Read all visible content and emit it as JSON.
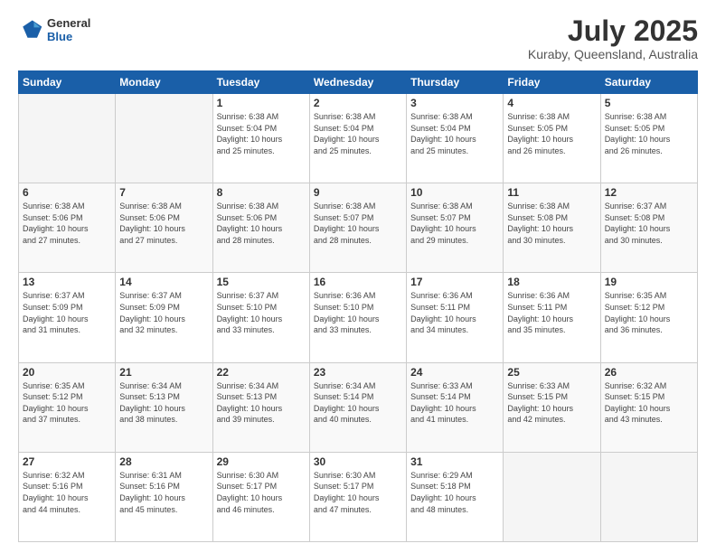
{
  "header": {
    "logo_line1": "General",
    "logo_line2": "Blue",
    "month_title": "July 2025",
    "location": "Kuraby, Queensland, Australia"
  },
  "days_of_week": [
    "Sunday",
    "Monday",
    "Tuesday",
    "Wednesday",
    "Thursday",
    "Friday",
    "Saturday"
  ],
  "weeks": [
    [
      {
        "day": "",
        "info": ""
      },
      {
        "day": "",
        "info": ""
      },
      {
        "day": "1",
        "info": "Sunrise: 6:38 AM\nSunset: 5:04 PM\nDaylight: 10 hours\nand 25 minutes."
      },
      {
        "day": "2",
        "info": "Sunrise: 6:38 AM\nSunset: 5:04 PM\nDaylight: 10 hours\nand 25 minutes."
      },
      {
        "day": "3",
        "info": "Sunrise: 6:38 AM\nSunset: 5:04 PM\nDaylight: 10 hours\nand 25 minutes."
      },
      {
        "day": "4",
        "info": "Sunrise: 6:38 AM\nSunset: 5:05 PM\nDaylight: 10 hours\nand 26 minutes."
      },
      {
        "day": "5",
        "info": "Sunrise: 6:38 AM\nSunset: 5:05 PM\nDaylight: 10 hours\nand 26 minutes."
      }
    ],
    [
      {
        "day": "6",
        "info": "Sunrise: 6:38 AM\nSunset: 5:06 PM\nDaylight: 10 hours\nand 27 minutes."
      },
      {
        "day": "7",
        "info": "Sunrise: 6:38 AM\nSunset: 5:06 PM\nDaylight: 10 hours\nand 27 minutes."
      },
      {
        "day": "8",
        "info": "Sunrise: 6:38 AM\nSunset: 5:06 PM\nDaylight: 10 hours\nand 28 minutes."
      },
      {
        "day": "9",
        "info": "Sunrise: 6:38 AM\nSunset: 5:07 PM\nDaylight: 10 hours\nand 28 minutes."
      },
      {
        "day": "10",
        "info": "Sunrise: 6:38 AM\nSunset: 5:07 PM\nDaylight: 10 hours\nand 29 minutes."
      },
      {
        "day": "11",
        "info": "Sunrise: 6:38 AM\nSunset: 5:08 PM\nDaylight: 10 hours\nand 30 minutes."
      },
      {
        "day": "12",
        "info": "Sunrise: 6:37 AM\nSunset: 5:08 PM\nDaylight: 10 hours\nand 30 minutes."
      }
    ],
    [
      {
        "day": "13",
        "info": "Sunrise: 6:37 AM\nSunset: 5:09 PM\nDaylight: 10 hours\nand 31 minutes."
      },
      {
        "day": "14",
        "info": "Sunrise: 6:37 AM\nSunset: 5:09 PM\nDaylight: 10 hours\nand 32 minutes."
      },
      {
        "day": "15",
        "info": "Sunrise: 6:37 AM\nSunset: 5:10 PM\nDaylight: 10 hours\nand 33 minutes."
      },
      {
        "day": "16",
        "info": "Sunrise: 6:36 AM\nSunset: 5:10 PM\nDaylight: 10 hours\nand 33 minutes."
      },
      {
        "day": "17",
        "info": "Sunrise: 6:36 AM\nSunset: 5:11 PM\nDaylight: 10 hours\nand 34 minutes."
      },
      {
        "day": "18",
        "info": "Sunrise: 6:36 AM\nSunset: 5:11 PM\nDaylight: 10 hours\nand 35 minutes."
      },
      {
        "day": "19",
        "info": "Sunrise: 6:35 AM\nSunset: 5:12 PM\nDaylight: 10 hours\nand 36 minutes."
      }
    ],
    [
      {
        "day": "20",
        "info": "Sunrise: 6:35 AM\nSunset: 5:12 PM\nDaylight: 10 hours\nand 37 minutes."
      },
      {
        "day": "21",
        "info": "Sunrise: 6:34 AM\nSunset: 5:13 PM\nDaylight: 10 hours\nand 38 minutes."
      },
      {
        "day": "22",
        "info": "Sunrise: 6:34 AM\nSunset: 5:13 PM\nDaylight: 10 hours\nand 39 minutes."
      },
      {
        "day": "23",
        "info": "Sunrise: 6:34 AM\nSunset: 5:14 PM\nDaylight: 10 hours\nand 40 minutes."
      },
      {
        "day": "24",
        "info": "Sunrise: 6:33 AM\nSunset: 5:14 PM\nDaylight: 10 hours\nand 41 minutes."
      },
      {
        "day": "25",
        "info": "Sunrise: 6:33 AM\nSunset: 5:15 PM\nDaylight: 10 hours\nand 42 minutes."
      },
      {
        "day": "26",
        "info": "Sunrise: 6:32 AM\nSunset: 5:15 PM\nDaylight: 10 hours\nand 43 minutes."
      }
    ],
    [
      {
        "day": "27",
        "info": "Sunrise: 6:32 AM\nSunset: 5:16 PM\nDaylight: 10 hours\nand 44 minutes."
      },
      {
        "day": "28",
        "info": "Sunrise: 6:31 AM\nSunset: 5:16 PM\nDaylight: 10 hours\nand 45 minutes."
      },
      {
        "day": "29",
        "info": "Sunrise: 6:30 AM\nSunset: 5:17 PM\nDaylight: 10 hours\nand 46 minutes."
      },
      {
        "day": "30",
        "info": "Sunrise: 6:30 AM\nSunset: 5:17 PM\nDaylight: 10 hours\nand 47 minutes."
      },
      {
        "day": "31",
        "info": "Sunrise: 6:29 AM\nSunset: 5:18 PM\nDaylight: 10 hours\nand 48 minutes."
      },
      {
        "day": "",
        "info": ""
      },
      {
        "day": "",
        "info": ""
      }
    ]
  ]
}
